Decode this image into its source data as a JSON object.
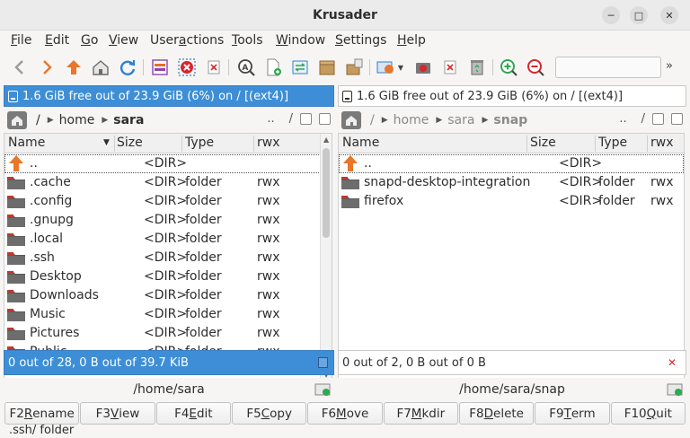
{
  "window": {
    "title": "Krusader"
  },
  "menu": [
    {
      "label": "File",
      "accel": "F",
      "rest": "ile"
    },
    {
      "label": "Edit",
      "accel": "E",
      "rest": "dit"
    },
    {
      "label": "Go",
      "accel": "G",
      "rest": "o"
    },
    {
      "label": "View",
      "accel": "V",
      "rest": "iew"
    },
    {
      "label": "Useractions",
      "pre": "User",
      "accel": "a",
      "rest": "ctions"
    },
    {
      "label": "Tools",
      "accel": "T",
      "rest": "ools"
    },
    {
      "label": "Window",
      "accel": "W",
      "rest": "indow"
    },
    {
      "label": "Settings",
      "accel": "S",
      "rest": "ettings"
    },
    {
      "label": "Help",
      "accel": "H",
      "rest": "elp"
    }
  ],
  "toolbar": {
    "more": "»",
    "search_placeholder": ""
  },
  "left_panel": {
    "free_space": "1.6 GiB free out of 23.9 GiB (6%) on / [(ext4)]",
    "path_root": "/",
    "path_parts": [
      "home",
      "sara"
    ],
    "path_tools": "..  /",
    "columns": {
      "name": "Name",
      "size": "Size",
      "type": "Type",
      "perm": "rwx"
    },
    "rows": [
      {
        "name": "..",
        "size": "<DIR>",
        "type": "",
        "perm": "",
        "up": true
      },
      {
        "name": ".cache",
        "size": "<DIR>",
        "type": "folder",
        "perm": "rwx"
      },
      {
        "name": ".config",
        "size": "<DIR>",
        "type": "folder",
        "perm": "rwx"
      },
      {
        "name": ".gnupg",
        "size": "<DIR>",
        "type": "folder",
        "perm": "rwx"
      },
      {
        "name": ".local",
        "size": "<DIR>",
        "type": "folder",
        "perm": "rwx"
      },
      {
        "name": ".ssh",
        "size": "<DIR>",
        "type": "folder",
        "perm": "rwx"
      },
      {
        "name": "Desktop",
        "size": "<DIR>",
        "type": "folder",
        "perm": "rwx"
      },
      {
        "name": "Downloads",
        "size": "<DIR>",
        "type": "folder",
        "perm": "rwx"
      },
      {
        "name": "Music",
        "size": "<DIR>",
        "type": "folder",
        "perm": "rwx"
      },
      {
        "name": "Pictures",
        "size": "<DIR>",
        "type": "folder",
        "perm": "rwx"
      },
      {
        "name": "Public",
        "size": "<DIR>",
        "type": "folder",
        "perm": "rwx"
      }
    ],
    "status": "0 out of 28, 0 B out of 39.7 KiB",
    "cwd": "/home/sara"
  },
  "right_panel": {
    "free_space": "1.6 GiB free out of 23.9 GiB (6%) on / [(ext4)]",
    "path_root": "/",
    "path_parts": [
      "home",
      "sara",
      "snap"
    ],
    "path_tools": "..  /",
    "columns": {
      "name": "Name",
      "size": "Size",
      "type": "Type",
      "perm": "rwx"
    },
    "rows": [
      {
        "name": "..",
        "size": "<DIR>",
        "type": "",
        "perm": "",
        "up": true
      },
      {
        "name": "snapd-desktop-integration",
        "size": "<DIR>",
        "type": "folder",
        "perm": "rwx"
      },
      {
        "name": "firefox",
        "size": "<DIR>",
        "type": "folder",
        "perm": "rwx"
      }
    ],
    "status": "0 out of 2, 0 B out of 0 B",
    "cwd": "/home/sara/snap"
  },
  "fkeys": [
    {
      "key": "F2",
      "accel": "R",
      "rest": "ename"
    },
    {
      "key": "F3",
      "accel": "V",
      "rest": "iew"
    },
    {
      "key": "F4",
      "accel": "E",
      "rest": "dit"
    },
    {
      "key": "F5",
      "accel": "C",
      "rest": "opy"
    },
    {
      "key": "F6",
      "accel": "M",
      "rest": "ove"
    },
    {
      "key": "F7",
      "accel": "M",
      "rest": "kdir"
    },
    {
      "key": "F8",
      "accel": "D",
      "rest": "elete"
    },
    {
      "key": "F9",
      "accel": "T",
      "rest": "erm"
    },
    {
      "key": "F10",
      "accel": "Q",
      "rest": "uit"
    }
  ],
  "bottom_status": ".ssh/  folder",
  "colors": {
    "accent": "#3d8ed6",
    "folder": "#5b5b5b",
    "folder_tab": "#c0392b",
    "up_arrow": "#e8762c"
  }
}
